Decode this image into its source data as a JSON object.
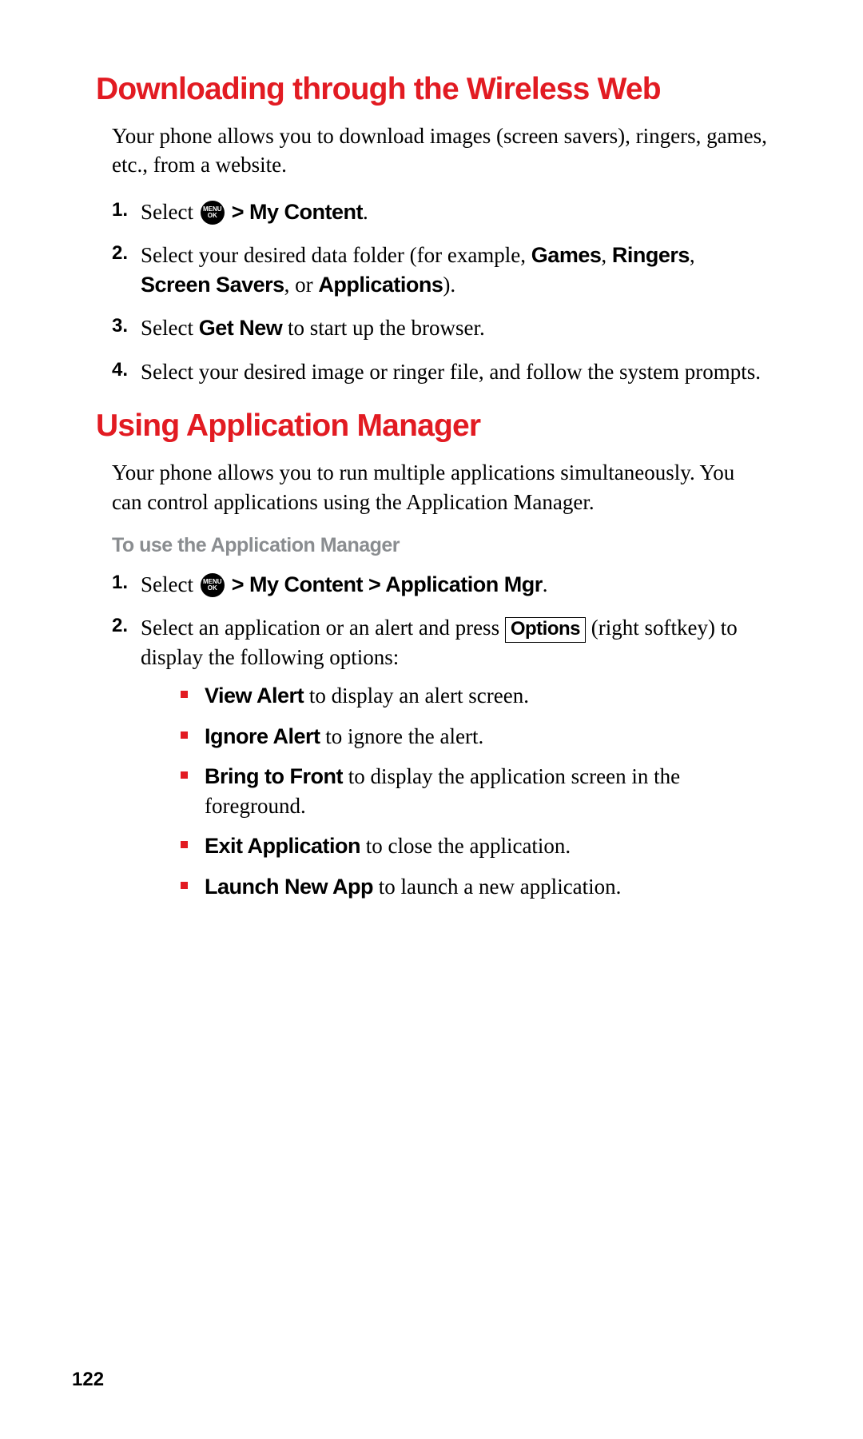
{
  "page_number": "122",
  "menu_icon": {
    "line1": "MENU",
    "line2": "OK"
  },
  "section1": {
    "title": "Downloading through the Wireless Web",
    "intro": "Your phone allows you to download images (screen savers), ringers, games, etc., from a website.",
    "steps": {
      "s1": {
        "select": "Select ",
        "path": " > My Content",
        "after": "."
      },
      "s2": {
        "t1": "Select your desired data folder (for example, ",
        "b1": "Games",
        "t2": ", ",
        "b2": "Ringers",
        "t3": ", ",
        "b3": "Screen Savers",
        "t4": ", or ",
        "b4": "Applications",
        "t5": ")."
      },
      "s3": {
        "t1": "Select ",
        "b1": "Get New",
        "t2": " to start up the browser."
      },
      "s4": "Select your desired image or ringer file, and follow the system prompts."
    }
  },
  "section2": {
    "title": "Using Application Manager",
    "intro": "Your phone allows you to run multiple applications simultaneously. You can control applications using the Application Manager.",
    "sub": "To use the Application Manager",
    "steps": {
      "s1": {
        "select": "Select ",
        "path": " > My Content > Application Mgr",
        "after": "."
      },
      "s2": {
        "t1": "Select an application or an alert and press ",
        "key": "Options",
        "t2": " (right softkey) to display the following options:"
      }
    },
    "bullets": {
      "b1": {
        "bold": "View Alert",
        "rest": " to display an alert screen."
      },
      "b2": {
        "bold": "Ignore Alert",
        "rest": " to ignore the alert."
      },
      "b3": {
        "bold": "Bring to Front",
        "rest": " to display the application screen in the foreground."
      },
      "b4": {
        "bold": "Exit Application",
        "rest": " to close the application."
      },
      "b5": {
        "bold": "Launch New App",
        "rest": " to launch a new application."
      }
    }
  }
}
